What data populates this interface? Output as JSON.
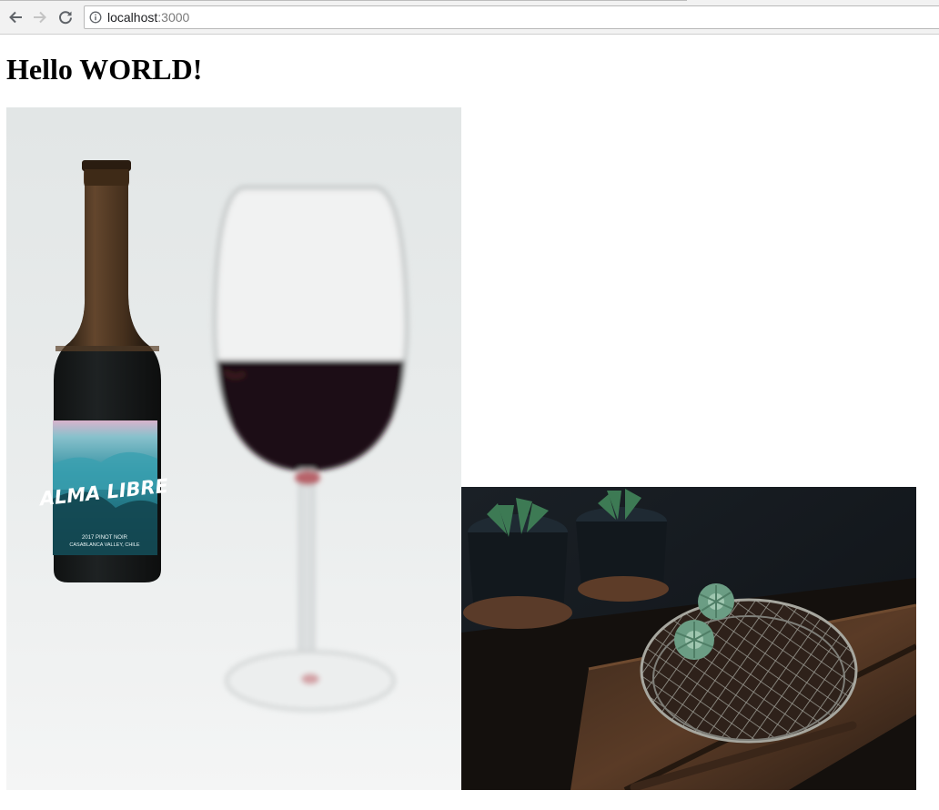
{
  "browser": {
    "url_host": "localhost",
    "url_port": ":3000",
    "icons": {
      "back": "back-arrow-icon",
      "forward": "forward-arrow-icon",
      "reload": "reload-icon",
      "site_info": "info-icon"
    }
  },
  "page": {
    "heading": "Hello WORLD!",
    "images": [
      {
        "description": "wine bottle and glass of red wine",
        "label": {
          "brand": "ALMA LIBRE",
          "line1": "2017 PINOT NOIR",
          "line2": "CASABLANCA VALLEY, CHILE"
        }
      },
      {
        "description": "succulents in pots on a wooden crate with a wire rack"
      }
    ]
  }
}
